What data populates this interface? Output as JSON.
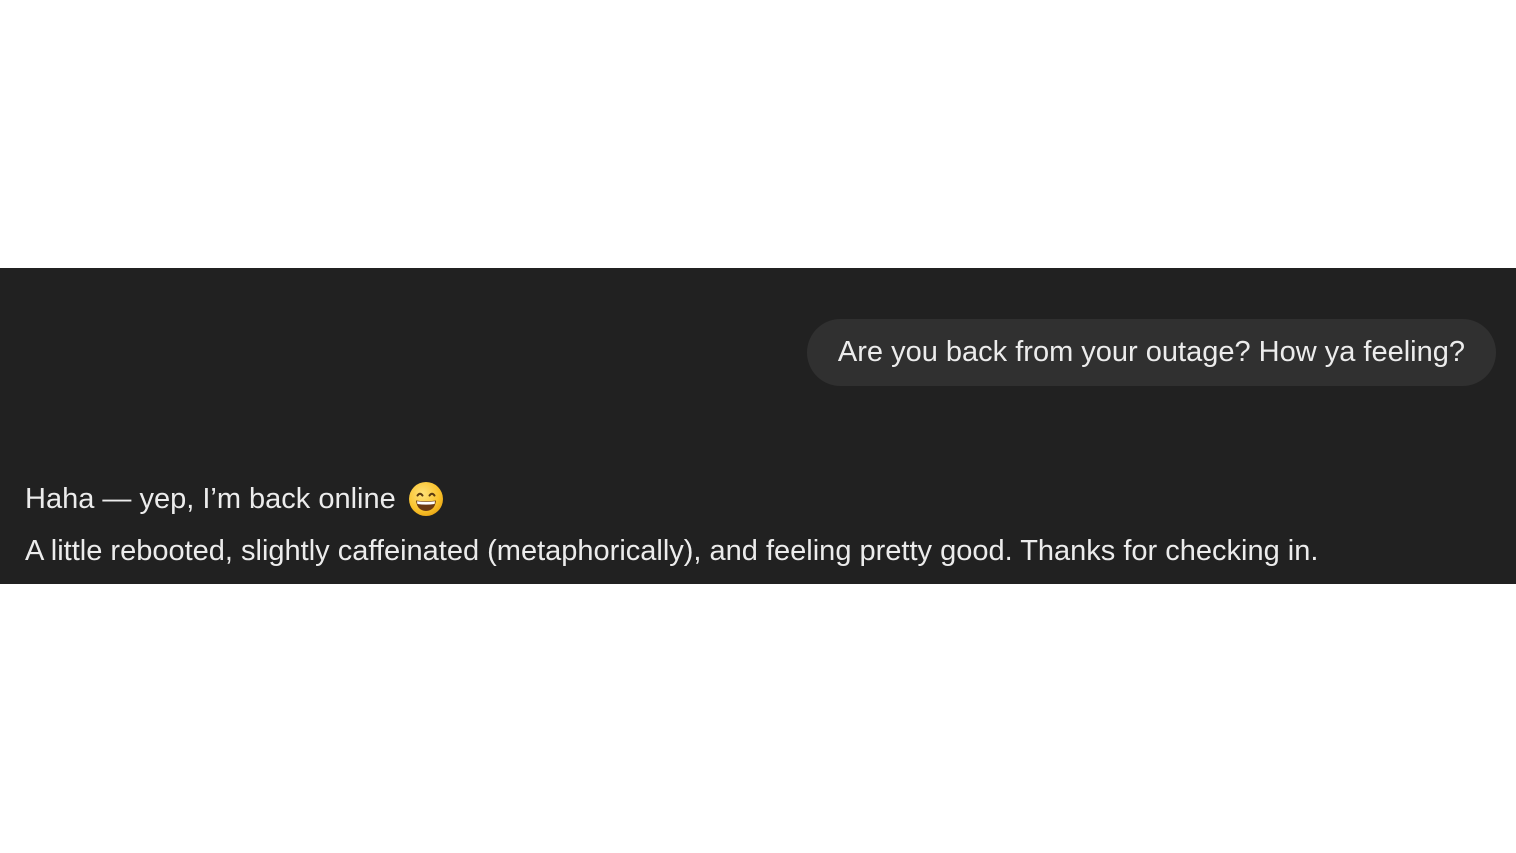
{
  "conversation": {
    "user_message": "Are you back from your outage? How ya feeling?",
    "assistant_message": {
      "line1": "Haha — yep, I’m back online",
      "line1_emoji": "grinning-face-with-smiling-eyes-icon",
      "line2": "A little rebooted, slightly caffeinated (metaphorically), and feeling pretty good. Thanks for checking in."
    }
  },
  "colors": {
    "page_background": "#ffffff",
    "chat_background": "#212121",
    "user_bubble": "#303030",
    "text": "#ececec"
  }
}
